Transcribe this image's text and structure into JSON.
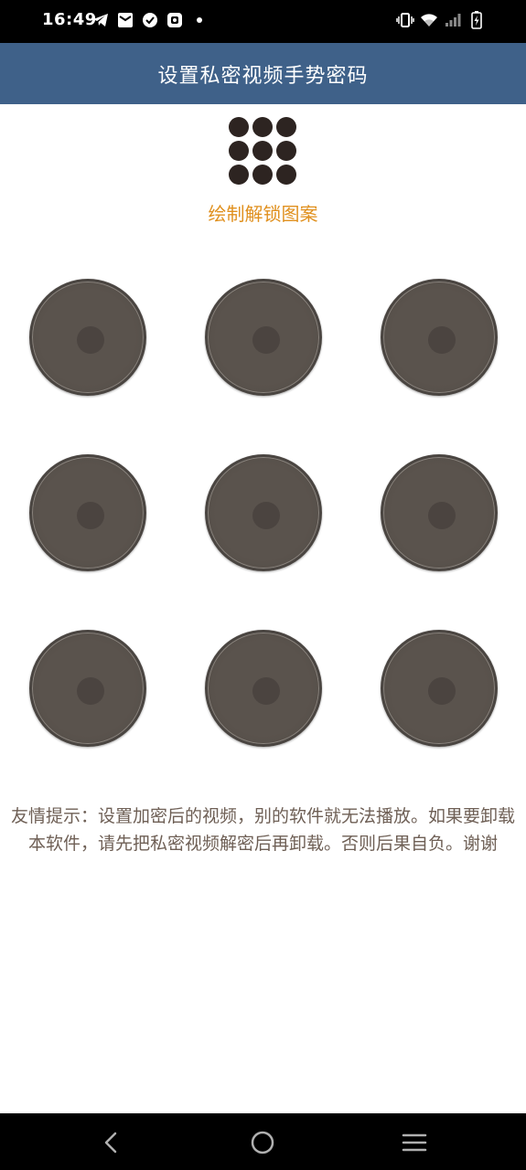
{
  "status_bar": {
    "time": "16:49",
    "left_icons": [
      "telegram-icon",
      "mail-icon",
      "check-circle-icon",
      "photo-app-icon",
      "notification-dot-icon"
    ],
    "right_icons": [
      "vibrate-icon",
      "wifi-icon",
      "signal-icon",
      "battery-charging-icon"
    ]
  },
  "header": {
    "title": "设置私密视频手势密码"
  },
  "preview": {
    "hint": "绘制解锁图案"
  },
  "tips": {
    "text": "友情提示：设置加密后的视频，别的软件就无法播放。如果要卸载本软件，请先把私密视频解密后再卸载。否则后果自负。谢谢"
  },
  "colors": {
    "title_bar": "#3f6189",
    "hint": "#e0901e",
    "tips": "#6e5f55",
    "node": "#5a534d"
  },
  "nav_bar": {
    "icons": [
      "back-icon",
      "home-icon",
      "menu-icon"
    ]
  }
}
